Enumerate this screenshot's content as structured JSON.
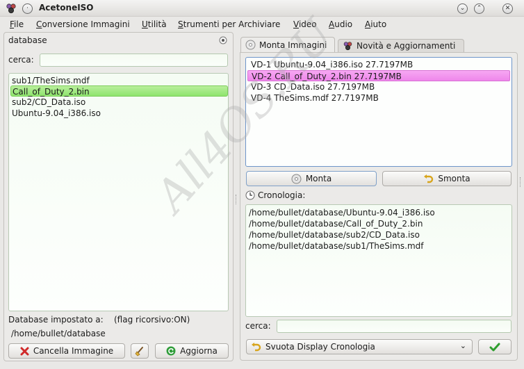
{
  "window": {
    "title": "AcetoneISO"
  },
  "menu": [
    {
      "label": "File",
      "ul": "F",
      "rest": "ile"
    },
    {
      "label": "Conversione Immagini",
      "ul": "C",
      "rest": "onversione Immagini"
    },
    {
      "label": "Utilità",
      "ul": "U",
      "rest": "tilità"
    },
    {
      "label": "Strumenti per Archiviare",
      "ul": "S",
      "rest": "trumenti per Archiviare"
    },
    {
      "label": "Video",
      "ul": "V",
      "rest": "ideo"
    },
    {
      "label": "Audio",
      "ul": "A",
      "rest": "udio"
    },
    {
      "label": "Aiuto",
      "ul": "A",
      "rest": "iuto"
    }
  ],
  "left": {
    "header": "database",
    "search_label": "cerca:",
    "search_value": "",
    "files": [
      {
        "name": "sub1/TheSims.mdf",
        "selected": false
      },
      {
        "name": "Call_of_Duty_2.bin",
        "selected": true
      },
      {
        "name": "sub2/CD_Data.iso",
        "selected": false
      },
      {
        "name": "Ubuntu-9.04_i386.iso",
        "selected": false
      }
    ],
    "db_set_label": "Database impostato a:",
    "flag_label": "(flag ricorsivo:ON)",
    "db_path": "/home/bullet/database",
    "delete_button": "Cancella Immagine",
    "refresh_button": "Aggiorna"
  },
  "right": {
    "tabs": [
      {
        "label": "Monta Immagini",
        "active": true
      },
      {
        "label": "Novità e Aggiornamenti",
        "active": false
      }
    ],
    "mounted": [
      {
        "text": "VD-1 Ubuntu-9.04_i386.iso  27.7197MB",
        "selected": false
      },
      {
        "text": "VD-2 Call_of_Duty_2.bin  27.7197MB",
        "selected": true
      },
      {
        "text": "VD-3 CD_Data.iso  27.7197MB",
        "selected": false
      },
      {
        "text": "VD-4 TheSims.mdf  27.7197MB",
        "selected": false
      }
    ],
    "mount_button": "Monta",
    "unmount_button": "Smonta",
    "history_label": "Cronologia:",
    "history": [
      "/home/bullet/database/Ubuntu-9.04_i386.iso",
      "/home/bullet/database/Call_of_Duty_2.bin",
      "/home/bullet/database/sub2/CD_Data.iso",
      "/home/bullet/database/sub1/TheSims.mdf"
    ],
    "search_label": "cerca:",
    "search_value": "",
    "clear_history_option": "Svuota Display Cronologia"
  },
  "watermark": "All4OS.RU",
  "colors": {
    "selection_green": "#8ee46d",
    "selection_pink": "#ee86ea",
    "accent_blue": "#6d95c9",
    "ok_green": "#2e9e2e",
    "delete_red": "#d02a2a"
  }
}
